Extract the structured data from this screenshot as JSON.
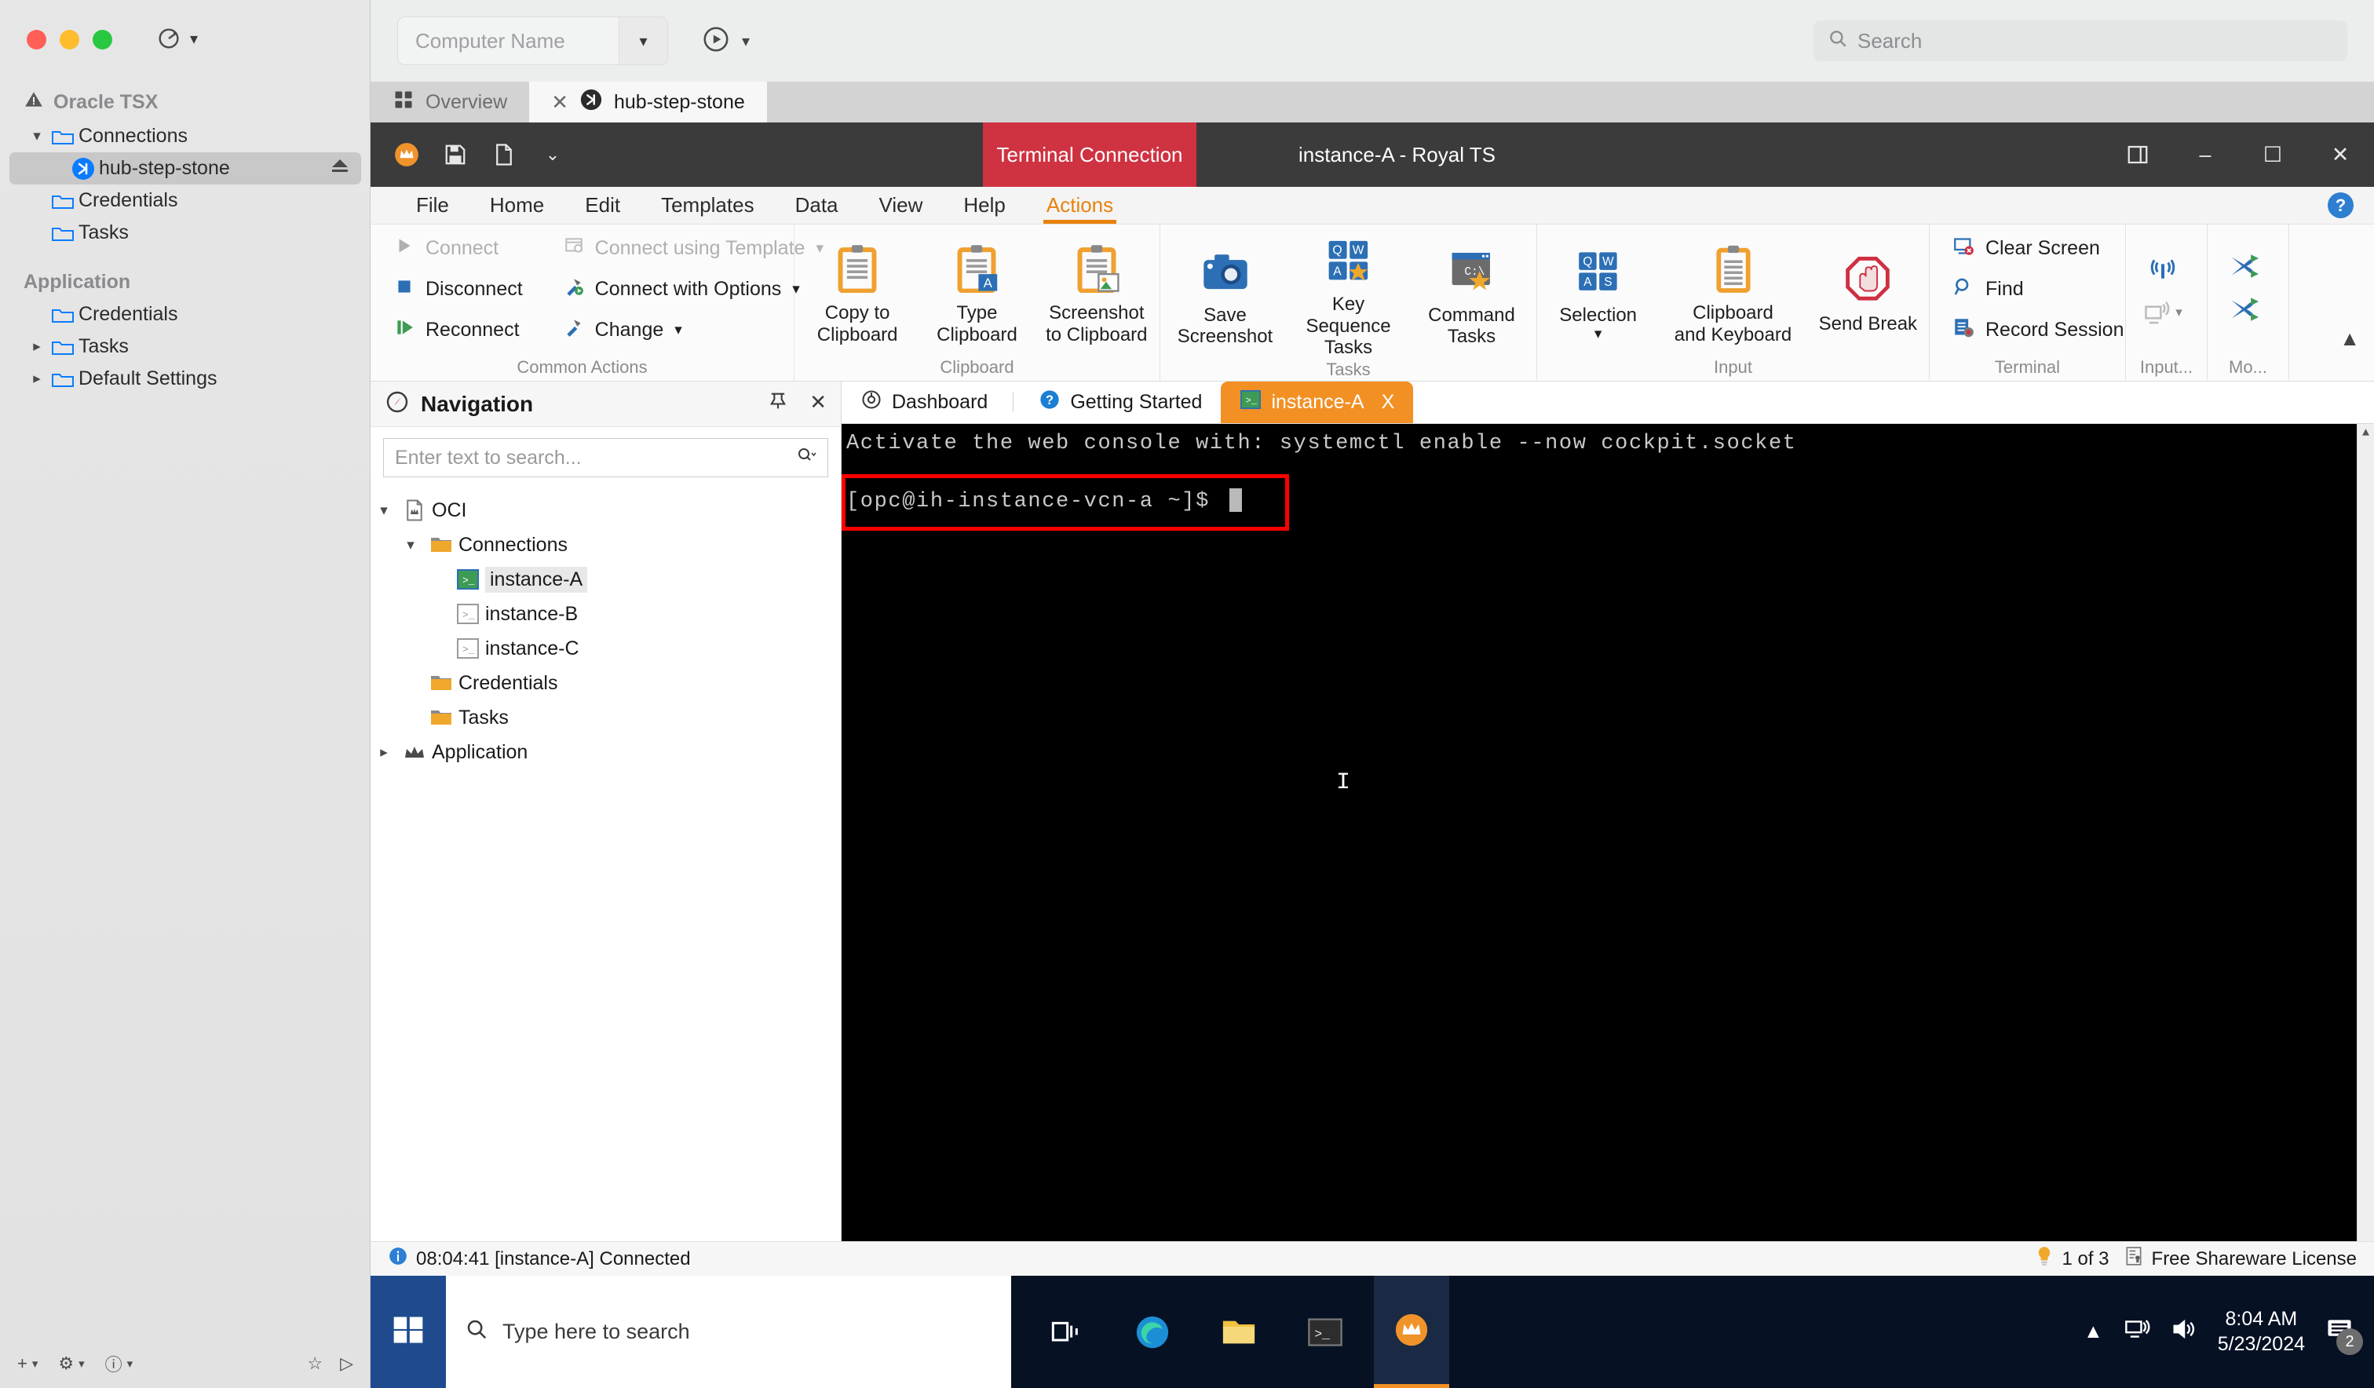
{
  "mac": {
    "toolbar": {
      "computer_name_placeholder": "Computer Name",
      "search_placeholder": "Search",
      "refresh_icon": "refresh-icon",
      "chevron_icon": "chevron-down-icon",
      "play_icon": "play-icon",
      "search_icon": "search-icon"
    },
    "sidebar": {
      "sections": [
        {
          "title": "Oracle TSX",
          "icon": "warning-triangle-icon",
          "items": [
            {
              "label": "Connections",
              "icon": "folder-icon",
              "chevron": "chevron-down-icon",
              "indent": 0,
              "selected": false
            },
            {
              "label": "hub-step-stone",
              "icon": "remote-desktop-icon",
              "chevron": "",
              "indent": 1,
              "selected": true,
              "trailing": "eject-icon"
            },
            {
              "label": "Credentials",
              "icon": "folder-icon",
              "chevron": "",
              "indent": 0,
              "selected": false
            },
            {
              "label": "Tasks",
              "icon": "folder-icon",
              "chevron": "",
              "indent": 0,
              "selected": false
            }
          ]
        },
        {
          "title": "Application",
          "icon": "",
          "items": [
            {
              "label": "Credentials",
              "icon": "folder-icon",
              "chevron": "",
              "indent": 0,
              "selected": false
            },
            {
              "label": "Tasks",
              "icon": "folder-icon",
              "chevron": "chevron-right-icon",
              "indent": 0,
              "selected": false
            },
            {
              "label": "Default Settings",
              "icon": "folder-icon",
              "chevron": "chevron-right-icon",
              "indent": 0,
              "selected": false
            }
          ]
        }
      ],
      "bottom_bar": {
        "add_icon": "add-plus-icon",
        "settings_icon": "gear-icon",
        "help_icon": "help-circle-icon",
        "favorite_icon": "star-icon",
        "run_icon": "play-outline-icon"
      }
    },
    "tabs": [
      {
        "label": "Overview",
        "icon": "grid-icon",
        "active": false,
        "closable": false
      },
      {
        "label": "hub-step-stone",
        "icon": "remote-desktop-icon",
        "active": true,
        "closable": true
      }
    ]
  },
  "royalts": {
    "titlebar": {
      "quick_icons": [
        "royal-crown-icon",
        "save-icon",
        "new-document-icon",
        "customize-chevron-icon"
      ],
      "context_badge": "Terminal Connection",
      "window_title": "instance-A - Royal TS",
      "buttons": [
        "layout-icon",
        "minimize-icon",
        "maximize-icon",
        "close-icon"
      ]
    },
    "menu": {
      "items": [
        {
          "label": "File",
          "active": false
        },
        {
          "label": "Home",
          "active": false
        },
        {
          "label": "Edit",
          "active": false
        },
        {
          "label": "Templates",
          "active": false
        },
        {
          "label": "Data",
          "active": false
        },
        {
          "label": "View",
          "active": false
        },
        {
          "label": "Help",
          "active": false
        },
        {
          "label": "Actions",
          "active": true
        }
      ],
      "help_icon": "help-icon"
    },
    "ribbon": {
      "groups": [
        {
          "name": "Common Actions",
          "small_left": [
            {
              "label": "Connect",
              "icon": "play-icon",
              "disabled": true
            },
            {
              "label": "Disconnect",
              "icon": "stop-square-icon",
              "disabled": false
            },
            {
              "label": "Reconnect",
              "icon": "reconnect-icon",
              "disabled": false
            }
          ],
          "small_right": [
            {
              "label": "Connect using Template",
              "icon": "template-icon",
              "disabled": true,
              "dropdown": true
            },
            {
              "label": "Connect with Options",
              "icon": "hammer-play-icon",
              "disabled": false,
              "dropdown": true
            },
            {
              "label": "Change",
              "icon": "hammer-icon",
              "disabled": false,
              "dropdown": true
            }
          ]
        },
        {
          "name": "Clipboard",
          "big": [
            {
              "label": "Copy to\nClipboard",
              "icon": "clipboard-icon",
              "dropdown": true
            },
            {
              "label": "Type\nClipboard",
              "icon": "clipboard-type-icon",
              "dropdown": true
            },
            {
              "label": "Screenshot\nto Clipboard",
              "icon": "clipboard-image-icon",
              "dropdown": false
            }
          ]
        },
        {
          "name": "Tasks",
          "big": [
            {
              "label": "Save\nScreenshot",
              "icon": "camera-icon",
              "dropdown": true
            },
            {
              "label": "Key Sequence\nTasks",
              "icon": "key-sequence-icon",
              "dropdown": true
            },
            {
              "label": "Command\nTasks",
              "icon": "command-task-icon",
              "dropdown": true
            }
          ]
        },
        {
          "name": "Input",
          "big": [
            {
              "label": "Selection",
              "icon": "keys-qwas-icon",
              "dropdown": true
            },
            {
              "label": "Clipboard\nand Keyboard",
              "icon": "clipboard-plain-icon",
              "dropdown": true
            },
            {
              "label": "Send Break",
              "icon": "stop-hand-icon",
              "dropdown": false
            }
          ]
        },
        {
          "name": "Terminal",
          "small_left": [
            {
              "label": "Clear Screen",
              "icon": "clear-screen-icon",
              "disabled": false
            },
            {
              "label": "Find",
              "icon": "magnifier-icon",
              "disabled": false
            },
            {
              "label": "Record Session",
              "icon": "record-session-icon",
              "disabled": false
            }
          ]
        },
        {
          "name": "Input...",
          "tiny": [
            {
              "icon": "broadcast-icon",
              "disabled": false
            },
            {
              "icon": "screen-broadcast-icon",
              "disabled": true,
              "dropdown": true
            }
          ]
        },
        {
          "name": "Mo...",
          "tiny": [
            {
              "icon": "shuffle-icon",
              "disabled": false
            },
            {
              "icon": "shuffle-icon",
              "disabled": false
            }
          ]
        }
      ],
      "collapse_icon": "chevron-up-icon"
    },
    "navigation": {
      "title": "Navigation",
      "title_icon": "compass-icon",
      "pin_icon": "pin-icon",
      "close_icon": "close-icon",
      "search_placeholder": "Enter text to search...",
      "search_icon": "search-dropdown-icon",
      "tree": [
        {
          "label": "OCI",
          "icon": "document-crown-icon",
          "chevron": "chevron-down-icon",
          "indent": 0,
          "selected": false
        },
        {
          "label": "Connections",
          "icon": "folder-orange-icon",
          "chevron": "chevron-down-icon",
          "indent": 1,
          "selected": false
        },
        {
          "label": "instance-A",
          "icon": "terminal-green-icon",
          "chevron": "",
          "indent": 2,
          "selected": true
        },
        {
          "label": "instance-B",
          "icon": "terminal-gray-icon",
          "chevron": "",
          "indent": 2,
          "selected": false
        },
        {
          "label": "instance-C",
          "icon": "terminal-gray-icon",
          "chevron": "",
          "indent": 2,
          "selected": false
        },
        {
          "label": "Credentials",
          "icon": "folder-orange-icon",
          "chevron": "",
          "indent": 1,
          "selected": false
        },
        {
          "label": "Tasks",
          "icon": "folder-orange-icon",
          "chevron": "",
          "indent": 1,
          "selected": false
        },
        {
          "label": "Application",
          "icon": "crown-icon",
          "chevron": "chevron-right-icon",
          "indent": 0,
          "selected": false
        }
      ]
    },
    "terminal": {
      "tabs": [
        {
          "label": "Dashboard",
          "icon": "dashboard-icon",
          "active": false,
          "closable": false
        },
        {
          "label": "Getting Started",
          "icon": "question-icon",
          "active": false,
          "closable": false
        },
        {
          "label": "instance-A",
          "icon": "terminal-green-icon",
          "active": true,
          "closable": true,
          "close_label": "X"
        }
      ],
      "lines": [
        "Activate the web console with: systemctl enable --now cockpit.socket",
        "[opc@ih-instance-vcn-a ~]$ "
      ],
      "prompt_highlight_color": "#ff0000",
      "cursor_visible": true
    },
    "statusbar": {
      "icon": "info-icon",
      "message": "08:04:41 [instance-A] Connected",
      "tip_icon": "lightbulb-icon",
      "tip_text": "1 of 3",
      "license_icon": "certificate-icon",
      "license_text": "Free Shareware License"
    }
  },
  "taskbar": {
    "start_icon": "windows-logo-icon",
    "search_placeholder": "Type here to search",
    "search_icon": "search-icon",
    "icons": [
      {
        "name": "task-view-icon",
        "active": false
      },
      {
        "name": "edge-browser-icon",
        "active": false
      },
      {
        "name": "file-explorer-icon",
        "active": false
      },
      {
        "name": "terminal-icon",
        "active": false
      },
      {
        "name": "royalts-icon",
        "active": true
      }
    ],
    "tray": {
      "chevron_icon": "chevron-up-icon",
      "network_icon": "network-icon",
      "volume_icon": "volume-icon",
      "time": "8:04 AM",
      "date": "5/23/2024",
      "notification_icon": "notification-icon",
      "notification_count": "2"
    }
  }
}
